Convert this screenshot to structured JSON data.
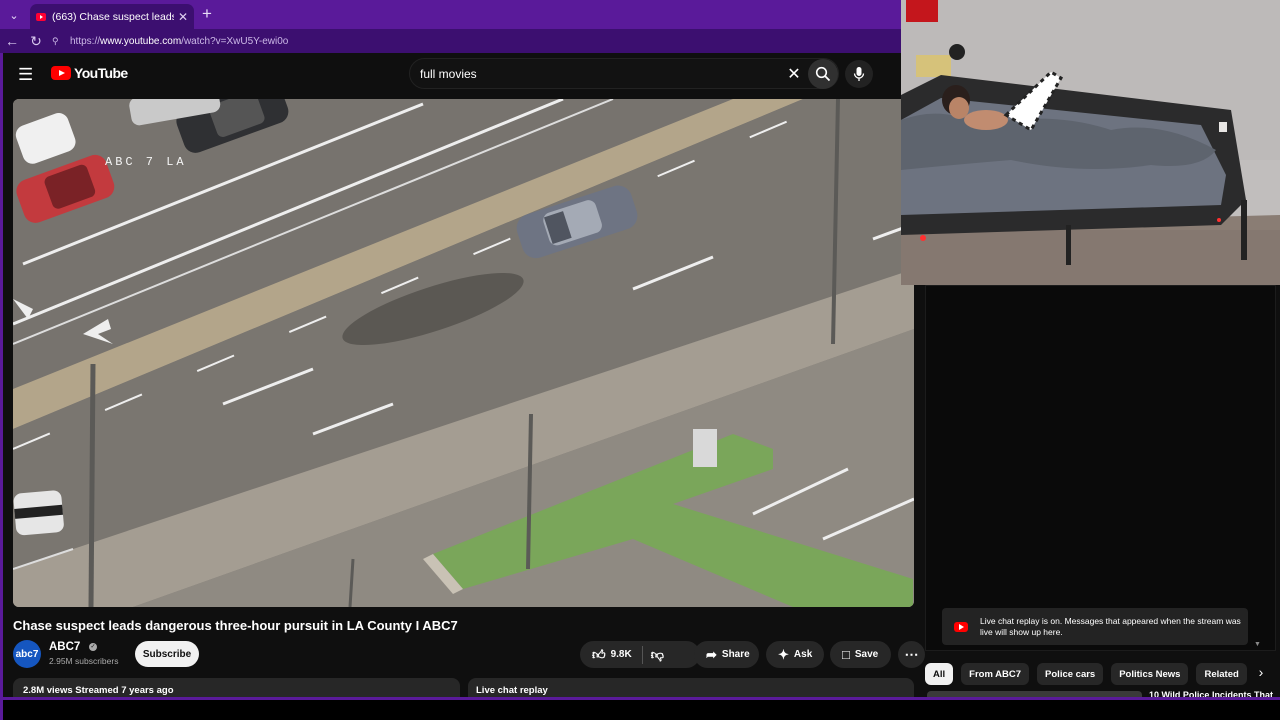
{
  "browser": {
    "tab_title": "(663) Chase suspect leads dangero",
    "url_prefix": "https://",
    "url_host": "www.youtube.com",
    "url_path": "/watch?v=XwU5Y-ewi0o"
  },
  "youtube": {
    "logo_text": "YouTube",
    "search_query": "full movies",
    "video_overlay": "ABC 7   LA",
    "video_title": "Chase suspect leads dangerous three-hour pursuit in LA County I ABC7",
    "channel": {
      "avatar_text": "abc7",
      "name": "ABC7",
      "subscribers": "2.95M subscribers",
      "subscribe_label": "Subscribe"
    },
    "actions": {
      "likes": "9.8K",
      "share": "Share",
      "ask": "Ask",
      "save": "Save"
    },
    "description_meta": "2.8M views  Streamed 7 years ago",
    "chat_replay_label": "Live chat replay"
  },
  "chat": {
    "notice": "Live chat replay is on. Messages that appeared when the stream was live will show up here."
  },
  "chips": [
    "All",
    "From ABC7",
    "Police cars",
    "Politics News",
    "Related"
  ],
  "next_video_title": "10 Wild Police Incidents That"
}
